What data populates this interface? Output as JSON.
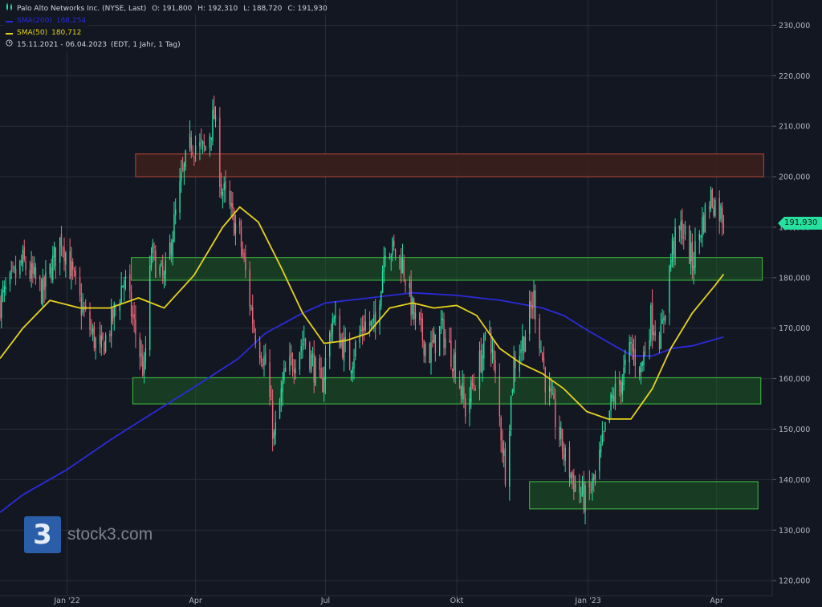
{
  "legend": {
    "ohlc_icon": "candlestick-icon",
    "symbol": "Palo Alto Networks Inc. (NYSE, Last)",
    "open": "O: 191,800",
    "high": "H: 192,310",
    "low": "L: 188,720",
    "close": "C: 191,930",
    "sma200_label": "SMA(200)",
    "sma200_value": "168,254",
    "sma50_label": "SMA(50)",
    "sma50_value": "180,712",
    "period_icon": "clock-icon",
    "period": "15.11.2021 - 06.04.2023",
    "period_detail": "(EDT, 1 Jahr, 1 Tag)"
  },
  "price_tag": "191,930",
  "logo": {
    "mark": "3",
    "text": "stock3.com"
  },
  "colors": {
    "background": "#131722",
    "grid": "#2a2e39",
    "up": "#26e0a0",
    "down": "#f0677a",
    "sma200": "#2b2bd9",
    "sma50": "#e7d21d",
    "support_fill": "#1c5a24",
    "support_border": "#3fbf3f",
    "resistance_fill": "#3a1f1c",
    "resistance_border": "#c0453a"
  },
  "chart_data": {
    "type": "candlestick",
    "y_ticks": [
      "120,000",
      "130,000",
      "140,000",
      "150,000",
      "160,000",
      "170,000",
      "180,000",
      "190,000",
      "200,000",
      "210,000",
      "220,000",
      "230,000"
    ],
    "x_ticks": [
      {
        "date": "2022-01-01",
        "label": "Jan '22"
      },
      {
        "date": "2022-04-01",
        "label": "Apr"
      },
      {
        "date": "2022-07-01",
        "label": "Jul"
      },
      {
        "date": "2022-10-01",
        "label": "Okt"
      },
      {
        "date": "2023-01-01",
        "label": "Jan '23"
      },
      {
        "date": "2023-04-01",
        "label": "Apr"
      }
    ],
    "ylim": [
      117000,
      235000
    ],
    "xlim": [
      "2021-11-15",
      "2023-05-10"
    ],
    "grid": true,
    "zones": [
      {
        "type": "resistance",
        "from": "2022-02-18",
        "to": "2023-05-04",
        "low": 200000,
        "high": 204500
      },
      {
        "type": "support",
        "from": "2022-02-15",
        "to": "2023-05-03",
        "low": 179500,
        "high": 184000
      },
      {
        "type": "support",
        "from": "2022-02-16",
        "to": "2023-05-02",
        "low": 155000,
        "high": 160200
      },
      {
        "type": "support",
        "from": "2022-11-21",
        "to": "2023-04-30",
        "low": 134200,
        "high": 139600
      }
    ],
    "candle_keypoints": [
      [
        "2021-11-15",
        175000
      ],
      [
        "2021-12-01",
        183000
      ],
      [
        "2021-12-15",
        177000
      ],
      [
        "2021-12-28",
        188000
      ],
      [
        "2022-01-10",
        175000
      ],
      [
        "2022-01-24",
        165000
      ],
      [
        "2022-02-01",
        171000
      ],
      [
        "2022-02-10",
        180000
      ],
      [
        "2022-02-24",
        161000
      ],
      [
        "2022-03-01",
        185000
      ],
      [
        "2022-03-10",
        179000
      ],
      [
        "2022-03-22",
        199000
      ],
      [
        "2022-03-29",
        207000
      ],
      [
        "2022-04-07",
        205000
      ],
      [
        "2022-04-14",
        212000
      ],
      [
        "2022-04-19",
        198000
      ],
      [
        "2022-05-02",
        188000
      ],
      [
        "2022-05-12",
        170000
      ],
      [
        "2022-05-20",
        163000
      ],
      [
        "2022-05-26",
        148000
      ],
      [
        "2022-06-02",
        160000
      ],
      [
        "2022-06-16",
        168000
      ],
      [
        "2022-06-28",
        158000
      ],
      [
        "2022-07-06",
        172000
      ],
      [
        "2022-07-18",
        163000
      ],
      [
        "2022-07-28",
        171000
      ],
      [
        "2022-08-05",
        170000
      ],
      [
        "2022-08-12",
        187000
      ],
      [
        "2022-08-24",
        183000
      ],
      [
        "2022-09-01",
        172000
      ],
      [
        "2022-09-12",
        165000
      ],
      [
        "2022-09-20",
        170000
      ],
      [
        "2022-09-30",
        163000
      ],
      [
        "2022-10-07",
        154000
      ],
      [
        "2022-10-14",
        160000
      ],
      [
        "2022-10-24",
        170000
      ],
      [
        "2022-10-31",
        152000
      ],
      [
        "2022-11-04",
        142000
      ],
      [
        "2022-11-10",
        163000
      ],
      [
        "2022-11-17",
        168000
      ],
      [
        "2022-11-24",
        176000
      ],
      [
        "2022-12-02",
        160000
      ],
      [
        "2022-12-09",
        152000
      ],
      [
        "2022-12-16",
        144000
      ],
      [
        "2022-12-23",
        139000
      ],
      [
        "2022-12-30",
        136000
      ],
      [
        "2023-01-06",
        140000
      ],
      [
        "2023-01-12",
        148000
      ],
      [
        "2023-01-18",
        156000
      ],
      [
        "2023-01-25",
        160000
      ],
      [
        "2023-01-31",
        166000
      ],
      [
        "2023-02-07",
        162000
      ],
      [
        "2023-02-14",
        172000
      ],
      [
        "2023-02-21",
        168000
      ],
      [
        "2023-03-01",
        186000
      ],
      [
        "2023-03-08",
        190000
      ],
      [
        "2023-03-15",
        183000
      ],
      [
        "2023-03-21",
        190000
      ],
      [
        "2023-03-28",
        196000
      ],
      [
        "2023-04-06",
        191930
      ]
    ],
    "sma50": [
      [
        "2021-11-15",
        164000
      ],
      [
        "2021-12-01",
        170000
      ],
      [
        "2021-12-20",
        175500
      ],
      [
        "2022-01-10",
        174000
      ],
      [
        "2022-01-31",
        174000
      ],
      [
        "2022-02-20",
        176000
      ],
      [
        "2022-03-10",
        174000
      ],
      [
        "2022-03-31",
        180500
      ],
      [
        "2022-04-20",
        190000
      ],
      [
        "2022-05-02",
        194000
      ],
      [
        "2022-05-15",
        191000
      ],
      [
        "2022-05-31",
        182000
      ],
      [
        "2022-06-15",
        173000
      ],
      [
        "2022-06-30",
        167000
      ],
      [
        "2022-07-15",
        167500
      ],
      [
        "2022-07-31",
        169000
      ],
      [
        "2022-08-15",
        174000
      ],
      [
        "2022-08-31",
        175000
      ],
      [
        "2022-09-15",
        174000
      ],
      [
        "2022-10-01",
        174500
      ],
      [
        "2022-10-15",
        172500
      ],
      [
        "2022-10-31",
        166000
      ],
      [
        "2022-11-15",
        163000
      ],
      [
        "2022-11-30",
        161000
      ],
      [
        "2022-12-15",
        158000
      ],
      [
        "2022-12-31",
        153500
      ],
      [
        "2023-01-15",
        152000
      ],
      [
        "2023-01-31",
        152000
      ],
      [
        "2023-02-15",
        158000
      ],
      [
        "2023-02-28",
        166000
      ],
      [
        "2023-03-15",
        173000
      ],
      [
        "2023-03-31",
        178500
      ],
      [
        "2023-04-06",
        180712
      ]
    ],
    "sma200": [
      [
        "2021-11-15",
        133500
      ],
      [
        "2021-12-01",
        137000
      ],
      [
        "2022-01-01",
        142000
      ],
      [
        "2022-02-01",
        148000
      ],
      [
        "2022-03-01",
        153000
      ],
      [
        "2022-04-01",
        158500
      ],
      [
        "2022-05-01",
        164000
      ],
      [
        "2022-05-20",
        169000
      ],
      [
        "2022-06-15",
        173000
      ],
      [
        "2022-07-01",
        175000
      ],
      [
        "2022-08-01",
        176000
      ],
      [
        "2022-08-31",
        177000
      ],
      [
        "2022-10-01",
        176500
      ],
      [
        "2022-11-01",
        175500
      ],
      [
        "2022-11-30",
        174000
      ],
      [
        "2022-12-15",
        172500
      ],
      [
        "2023-01-01",
        169500
      ],
      [
        "2023-02-01",
        164500
      ],
      [
        "2023-02-15",
        164500
      ],
      [
        "2023-03-01",
        166000
      ],
      [
        "2023-03-15",
        166500
      ],
      [
        "2023-04-06",
        168254
      ]
    ]
  }
}
